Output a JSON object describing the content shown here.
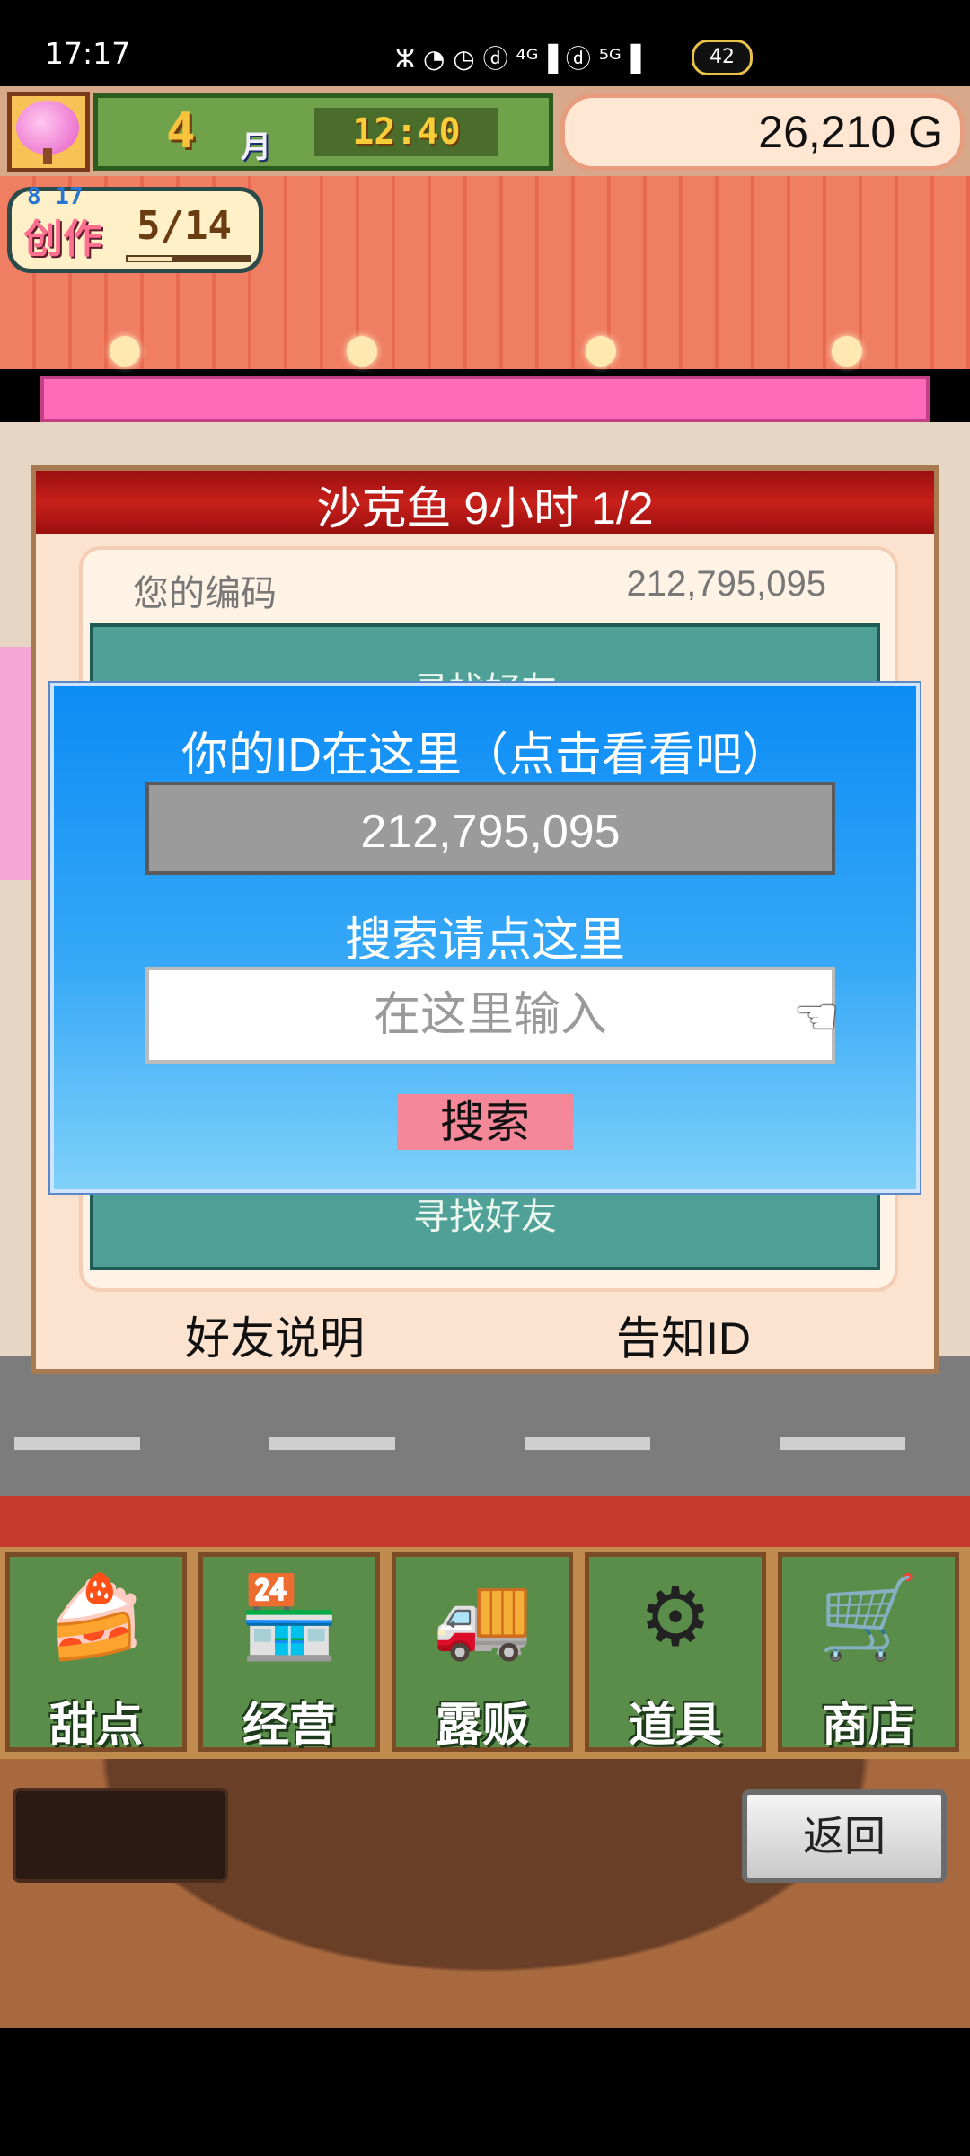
{
  "status_bar": {
    "time": "17:17",
    "icons": "ⵣ ◔ ◷ ⓓ ⁴ᴳ▐ ⓓ ⁵ᴳ▐",
    "battery": "42"
  },
  "hud": {
    "month_number": "4",
    "month_unit": "月",
    "clock": "12:40",
    "money": "26,210 G"
  },
  "create_badge": {
    "label": "创作",
    "date": "8  17",
    "count": "5/14",
    "progress": 0.36
  },
  "panel": {
    "title": "沙克鱼  9小时 1/2",
    "code_label": "您的编码",
    "code_value": "212,795,095",
    "teal_top_text": "寻找好友",
    "teal_bottom_text": "寻找好友",
    "link_friend_help": "好友说明",
    "link_tell_id": "告知ID"
  },
  "dialog": {
    "title": "你的ID在这里（点击看看吧）",
    "id_value": "212,795,095",
    "search_prompt": "搜索请点这里",
    "input_placeholder": "在这里输入",
    "search_button": "搜索"
  },
  "menu": [
    {
      "label": "甜点",
      "icon": "cake-icon"
    },
    {
      "label": "经营",
      "icon": "shop-building-icon"
    },
    {
      "label": "露贩",
      "icon": "food-truck-icon"
    },
    {
      "label": "道具",
      "icon": "gear-bag-icon"
    },
    {
      "label": "商店",
      "icon": "shopping-cart-icon"
    }
  ],
  "back_button": "返回",
  "colors": {
    "dialog_blue": "#0c8cf5",
    "search_pink": "#f48898",
    "header_red": "#c8201a",
    "teal": "#4fa197"
  }
}
